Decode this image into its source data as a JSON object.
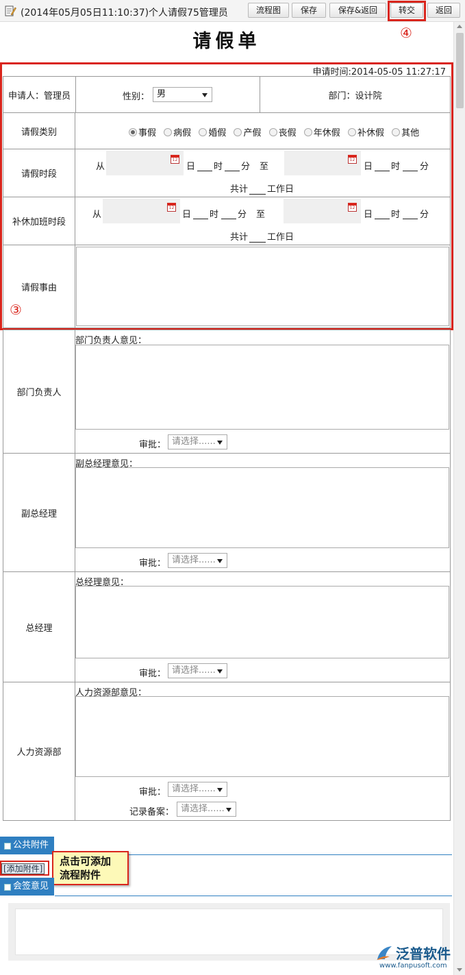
{
  "window": {
    "title": "(2014年05月05日11:10:37)个人请假75管理员"
  },
  "toolbar": {
    "buttons": [
      {
        "label": "流程图"
      },
      {
        "label": "保存"
      },
      {
        "label": "保存&返回"
      },
      {
        "label": "转交"
      },
      {
        "label": "返回"
      }
    ]
  },
  "annotations": {
    "step3": "③",
    "step4": "④"
  },
  "form": {
    "title": "请假单",
    "apply_time": "申请时间:2014-05-05 11:27:17",
    "applicant": "申请人：管理员",
    "gender_label": "性别：",
    "gender_value": "男",
    "department": "部门：设计院",
    "leave_type_label": "请假类别",
    "leave_types": [
      {
        "label": "事假",
        "checked": true
      },
      {
        "label": "病假",
        "checked": false
      },
      {
        "label": "婚假",
        "checked": false
      },
      {
        "label": "产假",
        "checked": false
      },
      {
        "label": "丧假",
        "checked": false
      },
      {
        "label": "年休假",
        "checked": false
      },
      {
        "label": "补休假",
        "checked": false
      },
      {
        "label": "其他",
        "checked": false
      }
    ],
    "leave_period_label": "请假时段",
    "overtime_period_label": "补休加班时段",
    "from": "从",
    "to": "至",
    "day": "日",
    "hour": "时",
    "minute": "分",
    "total": "共计",
    "workdays": "工作日",
    "reason_label": "请假事由"
  },
  "approvals": {
    "approve_label": "审批：",
    "select_placeholder": "请选择......",
    "record_label": "记录备案：",
    "dept_head": {
      "role": "部门负责人",
      "opinion_label": "部门负责人意见："
    },
    "deputy_gm": {
      "role": "副总经理",
      "opinion_label": "副总经理意见："
    },
    "gm": {
      "role": "总经理",
      "opinion_label": "总经理意见："
    },
    "hr": {
      "role": "人力资源部",
      "opinion_label": "人力资源部意见："
    }
  },
  "sections": {
    "public_attach": "公共附件",
    "add_attach": "[添加附件]",
    "countersign": "会签意见"
  },
  "tooltip": {
    "line1": "点击可添加",
    "line2": "流程附件"
  },
  "logo": {
    "brand": "泛普软件",
    "url": "www.fanpusoft.com"
  },
  "colors": {
    "highlight": "#d9251c",
    "section_tab": "#2f7fc1",
    "brand": "#1a5a8c",
    "tooltip_bg": "#fdf9b8"
  }
}
